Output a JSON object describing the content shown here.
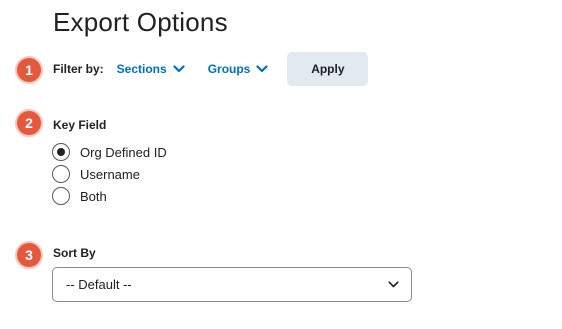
{
  "page": {
    "title": "Export Options"
  },
  "steps": [
    "1",
    "2",
    "3"
  ],
  "filter": {
    "label": "Filter by:",
    "sections_label": "Sections",
    "groups_label": "Groups",
    "apply_label": "Apply",
    "link_color": "#006fbf"
  },
  "key_field": {
    "label": "Key Field",
    "options": [
      {
        "label": "Org Defined ID",
        "checked": true
      },
      {
        "label": "Username",
        "checked": false
      },
      {
        "label": "Both",
        "checked": false
      }
    ]
  },
  "sort_by": {
    "label": "Sort By",
    "selected": "-- Default --"
  },
  "colors": {
    "badge": "#e2593f",
    "apply_bg": "#e3e9f1"
  },
  "icons": {
    "dropdown": "chevron-down-icon"
  }
}
